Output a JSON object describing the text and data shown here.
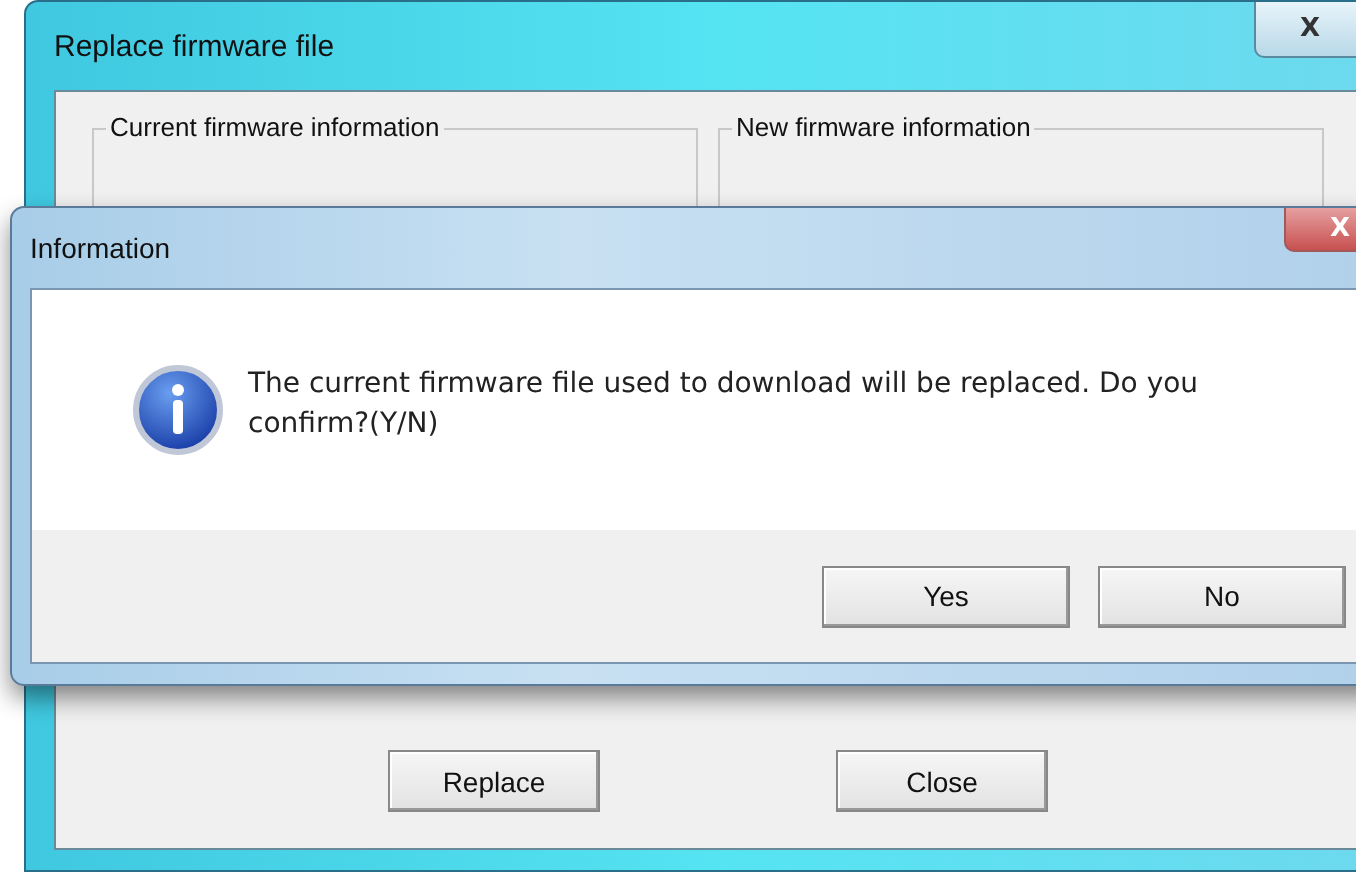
{
  "main_window": {
    "title": "Replace firmware file",
    "close": "X",
    "groups": [
      {
        "title": "Current firmware information"
      },
      {
        "title": "New firmware information"
      }
    ],
    "buttons": [
      "Replace",
      "Close"
    ]
  },
  "dialog": {
    "title": "Information",
    "close": "X",
    "message": "The current firmware file used to download will be replaced. Do you confirm?(Y/N)",
    "buttons": [
      "Yes",
      "No"
    ]
  }
}
